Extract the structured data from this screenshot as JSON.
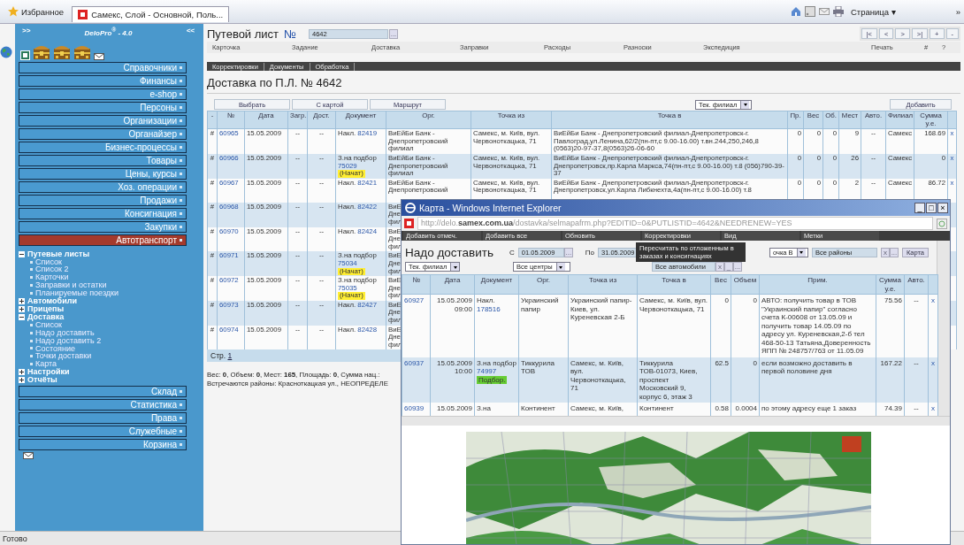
{
  "browser": {
    "favorites": "Избранное",
    "tab": "Самекс, Слой - Основной, Поль...",
    "page_menu": "Страница ▾",
    "more": "»"
  },
  "sidebar": {
    "expand": ">>",
    "brand": "DeloPro$^{®}$ - 4.0",
    "collapse": "<<",
    "menu_top": [
      {
        "label": "Справочники",
        "selected": false
      },
      {
        "label": "Финансы",
        "selected": false
      },
      {
        "label": "e-shop",
        "selected": false
      },
      {
        "label": "Персоны",
        "selected": false
      },
      {
        "label": "Организации",
        "selected": false
      },
      {
        "label": "Органайзер",
        "selected": false
      },
      {
        "label": "Бизнес-процессы",
        "selected": false
      },
      {
        "label": "Товары",
        "selected": false
      },
      {
        "label": "Цены, курсы",
        "selected": false
      },
      {
        "label": "Хоз. операции",
        "selected": false
      },
      {
        "label": "Продажи",
        "selected": false
      },
      {
        "label": "Консигнация",
        "selected": false
      },
      {
        "label": "Закупки",
        "selected": false
      },
      {
        "label": "Автотранспорт",
        "selected": true
      }
    ],
    "tree": [
      {
        "label": "Путевые листы",
        "expanded": true,
        "children": [
          {
            "label": "Список"
          },
          {
            "label": "Список 2"
          },
          {
            "label": "Карточки"
          },
          {
            "label": "Заправки и остатки"
          },
          {
            "label": "Планируемые поездки"
          }
        ]
      },
      {
        "label": "Автомобили",
        "expanded": false
      },
      {
        "label": "Прицепы",
        "expanded": false
      },
      {
        "label": "Доставка",
        "expanded": true,
        "children": [
          {
            "label": "Список"
          },
          {
            "label": "Надо доставить"
          },
          {
            "label": "Надо доставить 2"
          },
          {
            "label": "Состояние"
          },
          {
            "label": "Точки доставки"
          },
          {
            "label": "Карта"
          }
        ]
      },
      {
        "label": "Настройки",
        "expanded": false
      },
      {
        "label": "Отчёты",
        "expanded": false
      }
    ],
    "menu_bottom": [
      {
        "label": "Склад",
        "selected": false
      },
      {
        "label": "Статистика",
        "selected": false
      },
      {
        "label": "Права",
        "selected": false
      },
      {
        "label": "Служебные",
        "selected": false
      },
      {
        "label": "Корзина",
        "selected": false
      }
    ]
  },
  "main": {
    "waybill": {
      "label": "Путевой лист",
      "number_sign": "№",
      "value": "4642",
      "picker": "..."
    },
    "nav": [
      "|<",
      "<",
      ">",
      ">|",
      "+",
      "-"
    ],
    "tabs": [
      "Карточка",
      "Задание",
      "Доставка",
      "Заправки",
      "Расходы",
      "Разноски",
      "Экспедиция",
      "Печать",
      "#",
      "?"
    ],
    "subtabs": [
      "Корректировки",
      "Документы",
      "Обработка"
    ],
    "title": "Доставка по П.Л. № 4642",
    "actions": [
      "Выбрать",
      "С картой",
      "Маршрут"
    ],
    "branch_select": "Тек. филиал",
    "add": "Добавить",
    "columns": [
      "-",
      "№",
      "Дата",
      "Загр.",
      "Дост.",
      "Документ",
      "Орг.",
      "Точка из",
      "Точка в",
      "Пр.",
      "Вес",
      "Об.",
      "Мест",
      "Авто.",
      "Филиал",
      "Сумма у.е."
    ],
    "rows": [
      {
        "mark": "#",
        "id": "60965",
        "date": "15.05.2009",
        "load": "--",
        "deliv": "--",
        "doc": {
          "type": "Накл.",
          "number": "82419"
        },
        "org": "ВиЕйБи Банк - Днепропетровский филиал",
        "from": "Самекс, м. Київ, вул. Червоноткацька, 71",
        "to": "ВиЕйБи Банк - Днепропетровский филиал-Днепропетровск-г. Павлоград,ул.Ленина,62/2(пн-пт,с 9.00-16.00) т.вн.244,250,246,8 (0563)20-97-37,8(0563)26-06-60",
        "pr": "0",
        "weight": "0",
        "vol": "0",
        "places": "9",
        "auto": "--",
        "branch": "Самекс",
        "sum": "168.69",
        "del": "x"
      },
      {
        "mark": "#",
        "id": "60966",
        "date": "15.05.2009",
        "load": "--",
        "deliv": "--",
        "doc": {
          "type": "З.на подбор",
          "number": "75029",
          "status": {
            "label": "(Начат)",
            "color": "#ffee33"
          }
        },
        "org": "ВиЕйБи Банк - Днепропетровский филиал",
        "from": "Самекс, м. Київ, вул. Червоноткацька, 71",
        "to": "ВиЕйБи Банк - Днепропетровский филиал-Днепропетровск-г. Днепропетровск,пр.Карла Маркса,74(пн-пт,с 9.00-16.00) т.8 (056)790-39-37",
        "pr": "0",
        "weight": "0",
        "vol": "0",
        "places": "26",
        "auto": "--",
        "branch": "Самекс",
        "sum": "0",
        "del": "x"
      },
      {
        "mark": "#",
        "id": "60967",
        "date": "15.05.2009",
        "load": "--",
        "deliv": "--",
        "doc": {
          "type": "Накл.",
          "number": "82421"
        },
        "org": "ВиЕйБи Банк - Днепропетровский",
        "from": "Самекс, м. Київ, вул. Червоноткацька, 71",
        "to": "ВиЕйБи Банк - Днепропетровский филиал-Днепропетровск-г. Днепропетровск,ул.Карла Либкнехта,4а(пн-пт,с 9.00-16.00) т.8",
        "pr": "0",
        "weight": "0",
        "vol": "0",
        "places": "2",
        "auto": "--",
        "branch": "Самекс",
        "sum": "86.72",
        "del": "x"
      },
      {
        "mark": "#",
        "id": "60968",
        "date": "15.05.2009",
        "load": "--",
        "deliv": "--",
        "doc": {
          "type": "Накл.",
          "number": "82422"
        },
        "org": "ВиЕ\nДне\nфил"
      },
      {
        "mark": "#",
        "id": "60970",
        "date": "15.05.2009",
        "load": "--",
        "deliv": "--",
        "doc": {
          "type": "Накл.",
          "number": "82424"
        },
        "org": "ВиЕ\nДне\nфил"
      },
      {
        "mark": "#",
        "id": "60971",
        "date": "15.05.2009",
        "load": "--",
        "deliv": "--",
        "doc": {
          "type": "З.на подбор",
          "number": "75034",
          "status": {
            "label": "(Начат)",
            "color": "#ffee33"
          }
        },
        "org": "ВиЕ\nДне\nфил"
      },
      {
        "mark": "#",
        "id": "60972",
        "date": "15.05.2009",
        "load": "--",
        "deliv": "--",
        "doc": {
          "type": "З.на подбор",
          "number": "75035",
          "status": {
            "label": "(Начат)",
            "color": "#ffee33"
          }
        },
        "org": "ВиЕ\nДне\nфил"
      },
      {
        "mark": "#",
        "id": "60973",
        "date": "15.05.2009",
        "load": "--",
        "deliv": "--",
        "doc": {
          "type": "Накл.",
          "number": "82427"
        },
        "org": "ВиЕ\nДне\nфил"
      },
      {
        "mark": "#",
        "id": "60974",
        "date": "15.05.2009",
        "load": "--",
        "deliv": "--",
        "doc": {
          "type": "Накл.",
          "number": "82428"
        },
        "org": "ВиЕ\nДне\nфил"
      }
    ],
    "pager": {
      "label": "Стр.",
      "page": "1"
    },
    "summary": [
      "Вес: **0**, Объем: **0**, Мест: **165**, Площадь: **0**, Сумма нац.:",
      "Встречаются районы: Красноткацкая ул., НЕОПРЕДЕЛЕ"
    ]
  },
  "popup": {
    "title": "Карта - Windows Internet Explorer",
    "window_buttons": [
      "_",
      "□",
      "×"
    ],
    "url": "http://delo.**samex.com.ua**/dostavka/selmapafrm.php?EDITID=0&PUTLISTID=4642&NEEDRENEW=YES",
    "menu": [
      "Добавить отмеч.",
      "Добавить все",
      "Обновить",
      "Корректировки",
      "Вид",
      "Метки"
    ],
    "tooltip": "Пересчитать по отложенным в заказах и консигнациях",
    "heading": "Надо доставить",
    "from_label": "С",
    "from_date": "01.05.2009",
    "to_label": "По",
    "to_date": "31.05.2009",
    "picker": "...",
    "point_select": "очка В",
    "district": "Все районы",
    "clear": "x",
    "map_button": "Карта",
    "branch_select": "Тек. филиал",
    "center_select": "Все центры",
    "vehicles": "Все автомобили",
    "vehicles_clear": "x",
    "vehicles_min": "_",
    "columns": [
      "№",
      "Дата",
      "Документ",
      "Орг.",
      "Точка из",
      "Точка в",
      "Вес",
      "Объем",
      "Прим.",
      "Сумма у.е.",
      "Авто."
    ],
    "rows": [
      {
        "id": "60927",
        "date": "15.05.2009 09:00",
        "doc": {
          "type": "Накл.",
          "number": "178516"
        },
        "org": "Украинский папир",
        "from": "Украинский папир-Киев, ул. Куреневская 2-Б",
        "to": "Самекс, м. Київ, вул. Червоноткацька, 71",
        "weight": "0",
        "vol": "0",
        "note": "АВТО: получить товар в ТОВ \"Украинский папир\" согласно счета К-00608 от 13.05.09 и получить товар 14.05.09 по адресу ул. Куреневская,2-б тел 468-50-13 Татьяна,Доверенность ЯПП № 248757/763 от 11.05.09",
        "sum": "75.56",
        "auto": "--",
        "del": "x"
      },
      {
        "id": "60937",
        "date": "15.05.2009 10:00",
        "doc": {
          "type": "З.на подбор",
          "number": "74997",
          "status": {
            "label": "Подбор.",
            "color": "#66cc33"
          }
        },
        "org": "Тиккурила ТОВ",
        "from": "Самекс, м. Київ, вул. Червоноткацька, 71",
        "to": "Тиккурила ТОВ-01073, Киев, проспект Московский 9, корпус 6, этаж 3",
        "weight": "62.5",
        "vol": "0",
        "note": "если возможно доставить в первой половине дня",
        "sum": "167.22",
        "auto": "--",
        "del": "x"
      },
      {
        "id": "60939",
        "date": "15.05.2009",
        "doc": {
          "type": "З.на"
        },
        "org": "Континент",
        "from": "Самекс, м. Київ,",
        "to": "Континент",
        "weight": "0.58",
        "vol": "0.0004",
        "note": "по этому адресу еще 1 заказ",
        "sum": "74.39",
        "auto": "--",
        "del": "x"
      }
    ]
  },
  "status_bar": "Готово"
}
